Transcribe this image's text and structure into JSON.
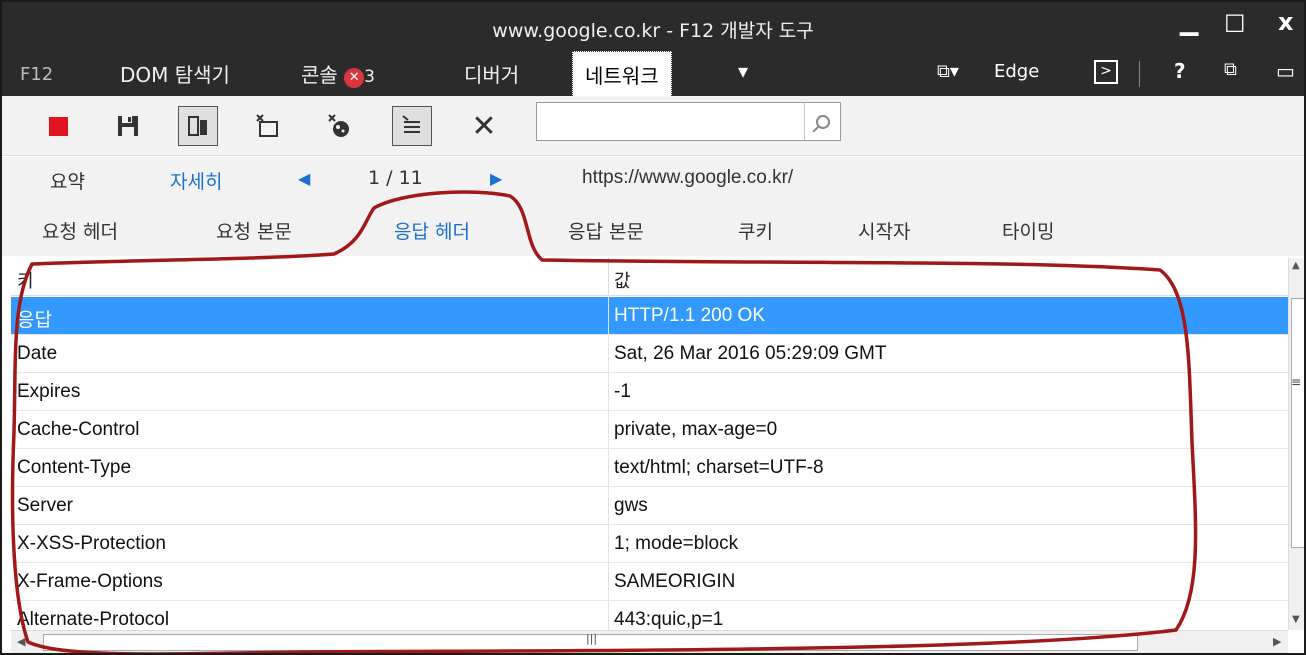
{
  "window": {
    "title": "www.google.co.kr - F12 개발자 도구",
    "minimize": "▁",
    "maximize": "☐",
    "close": "x"
  },
  "menu": {
    "f12": "F12",
    "dom_explorer": "DOM 탐색기",
    "console": "콘솔",
    "console_error_count": "3",
    "debugger": "디버거",
    "network": "네트워크",
    "more": "▾",
    "emulation": "Edge",
    "help": "?"
  },
  "toolbar": {
    "search_value": "",
    "icons": [
      "stop-record-icon",
      "save-icon",
      "always-refresh-icon",
      "clear-session-icon",
      "clear-cache-icon",
      "content-type-filter-icon",
      "clear-icon",
      "search-icon"
    ]
  },
  "summary": {
    "summary_label": "요약",
    "details_label": "자세히",
    "page_indicator": "1 / 11",
    "url": "https://www.google.co.kr/"
  },
  "subtabs": {
    "request_headers": "요청 헤더",
    "request_body": "요청 본문",
    "response_headers": "응답 헤더",
    "response_body": "응답 본문",
    "cookies": "쿠키",
    "initiator": "시작자",
    "timing": "타이밍"
  },
  "grid": {
    "columns": [
      "키",
      "값"
    ],
    "rows": [
      {
        "key": "응답",
        "value": "HTTP/1.1 200 OK"
      },
      {
        "key": "Date",
        "value": "Sat, 26 Mar 2016 05:29:09 GMT"
      },
      {
        "key": "Expires",
        "value": "-1"
      },
      {
        "key": "Cache-Control",
        "value": "private, max-age=0"
      },
      {
        "key": "Content-Type",
        "value": "text/html; charset=UTF-8"
      },
      {
        "key": "Server",
        "value": "gws"
      },
      {
        "key": "X-XSS-Protection",
        "value": "1; mode=block"
      },
      {
        "key": "X-Frame-Options",
        "value": "SAMEORIGIN"
      },
      {
        "key": "Alternate-Protocol",
        "value": "443:quic,p=1"
      }
    ],
    "selected_row_index": 0
  },
  "colors": {
    "title_bg": "#2b2b2b",
    "accent": "#1a6fd0",
    "selection": "#3399ff",
    "annotation": "#a01818"
  }
}
